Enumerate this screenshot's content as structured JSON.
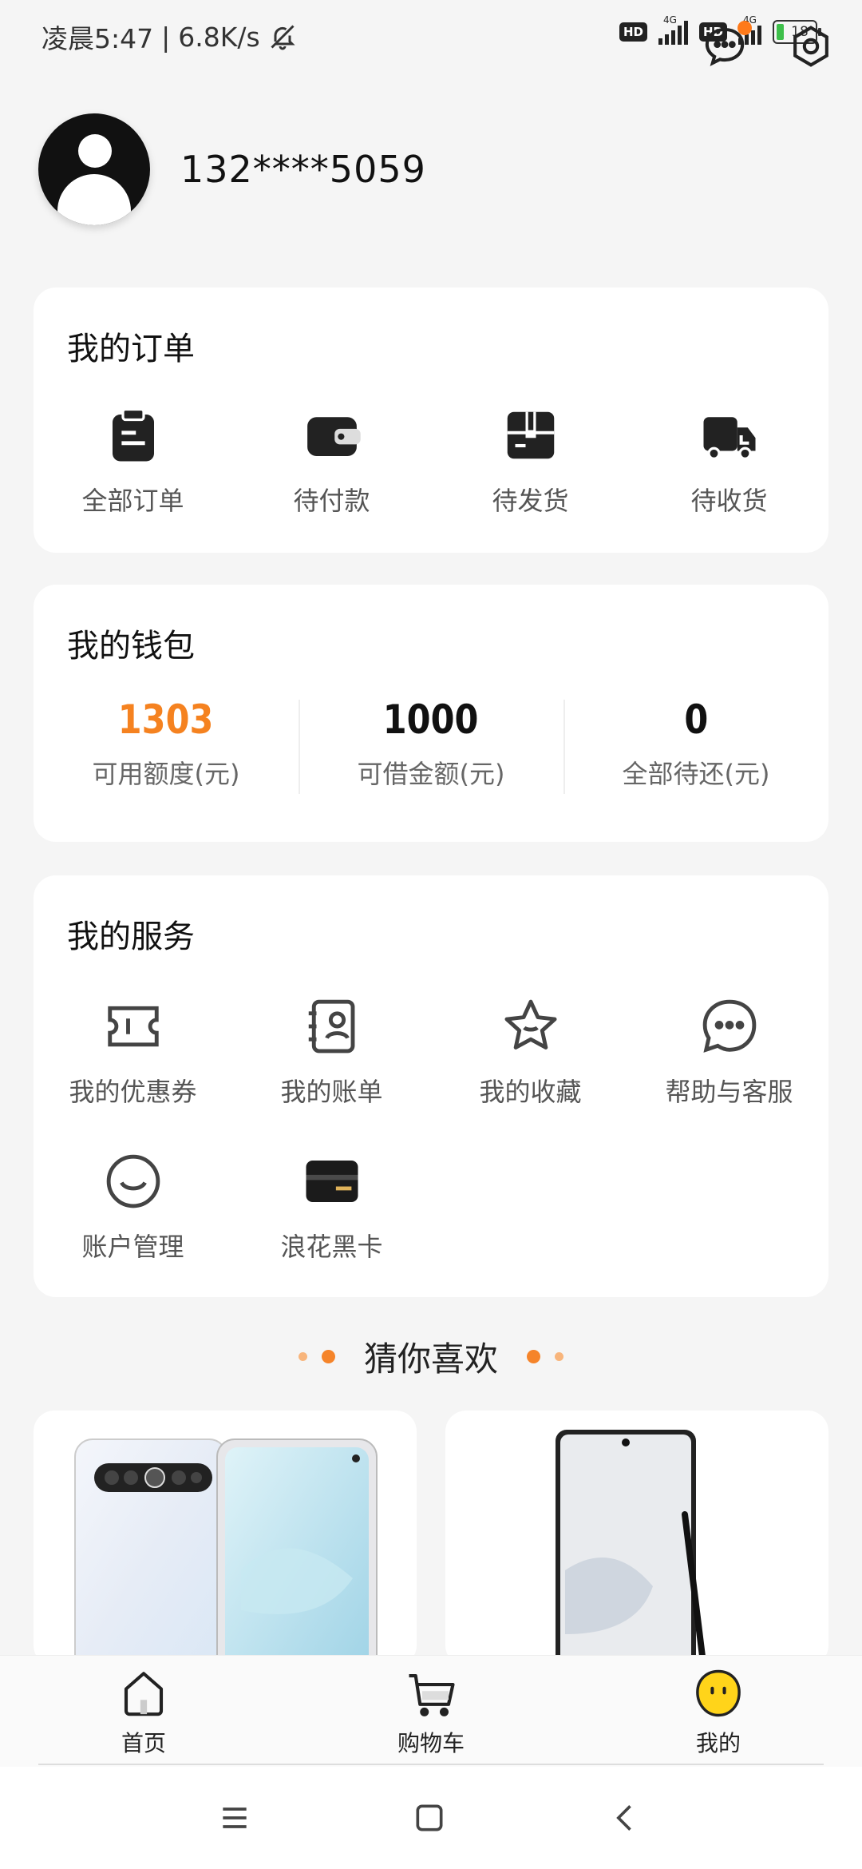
{
  "status_bar": {
    "time": "凌晨5:47",
    "speed": "6.8K/s",
    "hd1": "HD",
    "hd2": "HD",
    "net1": "4G",
    "net2": "4G",
    "battery": "18"
  },
  "profile": {
    "phone": "132****5059"
  },
  "orders": {
    "title": "我的订单",
    "items": [
      {
        "label": "全部订单",
        "icon": "clipboard-icon"
      },
      {
        "label": "待付款",
        "icon": "wallet-icon"
      },
      {
        "label": "待发货",
        "icon": "box-icon"
      },
      {
        "label": "待收货",
        "icon": "truck-icon"
      }
    ]
  },
  "wallet": {
    "title": "我的钱包",
    "items": [
      {
        "value": "1303",
        "label": "可用额度(元)"
      },
      {
        "value": "1000",
        "label": "可借金额(元)"
      },
      {
        "value": "0",
        "label": "全部待还(元)"
      }
    ],
    "highlight_color": "#f58220"
  },
  "services": {
    "title": "我的服务",
    "items": [
      {
        "label": "我的优惠券",
        "icon": "coupon-icon"
      },
      {
        "label": "我的账单",
        "icon": "bill-icon"
      },
      {
        "label": "我的收藏",
        "icon": "star-icon"
      },
      {
        "label": "帮助与客服",
        "icon": "chat-icon"
      },
      {
        "label": "账户管理",
        "icon": "smile-icon"
      },
      {
        "label": "浪花黑卡",
        "icon": "black-card-icon"
      }
    ]
  },
  "recommend": {
    "title": "猜你喜欢"
  },
  "tabs": [
    {
      "label": "首页",
      "icon": "home-icon"
    },
    {
      "label": "购物车",
      "icon": "cart-icon"
    },
    {
      "label": "我的",
      "icon": "mine-icon"
    }
  ],
  "accent_color": "#f5842a"
}
